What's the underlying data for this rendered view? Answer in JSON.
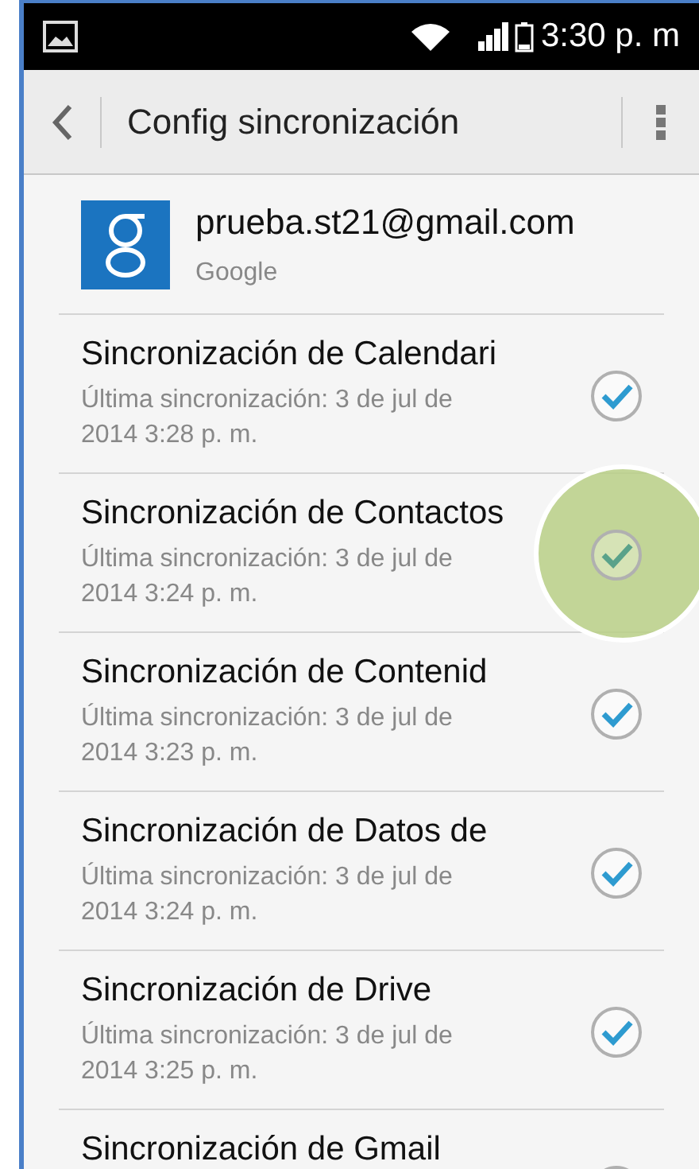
{
  "status_bar": {
    "time": "3:30 p. m"
  },
  "action_bar": {
    "title": "Config sincronización"
  },
  "account": {
    "email": "prueba.st21@gmail.com",
    "type": "Google"
  },
  "sync_items": [
    {
      "title": "Sincronización de Calendari",
      "subtitle": "Última sincronización: 3 de jul de 2014 3:28 p. m.",
      "checked": true,
      "pressed": false
    },
    {
      "title": "Sincronización de Contactos",
      "subtitle": "Última sincronización: 3 de jul de 2014 3:24 p. m.",
      "checked": true,
      "pressed": true
    },
    {
      "title": "Sincronización de Contenid",
      "subtitle": "Última sincronización: 3 de jul de 2014 3:23 p. m.",
      "checked": true,
      "pressed": false
    },
    {
      "title": "Sincronización de Datos de",
      "subtitle": "Última sincronización: 3 de jul de 2014 3:24 p. m.",
      "checked": true,
      "pressed": false
    },
    {
      "title": "Sincronización de Drive",
      "subtitle": "Última sincronización: 3 de jul de 2014 3:25 p. m.",
      "checked": true,
      "pressed": false
    },
    {
      "title": "Sincronización de Gmail",
      "pressed": false
    }
  ]
}
